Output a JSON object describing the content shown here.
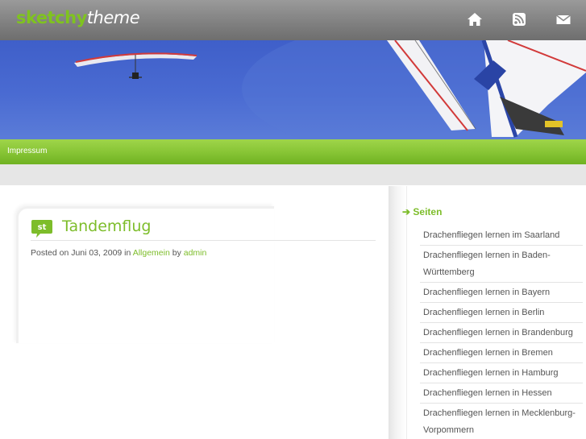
{
  "header": {
    "logo_part1": "sketchy",
    "logo_part2": "theme",
    "icons": [
      "home-icon",
      "rss-icon",
      "mail-icon"
    ]
  },
  "nav": {
    "items": [
      {
        "label": "Impressum"
      }
    ]
  },
  "post": {
    "title": "Tandemflug",
    "meta_prefix": "Posted on Juni 03, 2009 in",
    "category": "Allgemein",
    "by": "by",
    "author": "admin",
    "icon_label": "st"
  },
  "sidebar": {
    "heading": "Seiten",
    "items": [
      "Drachenfliegen lernen im Saarland",
      "Drachenfliegen lernen in Baden-Württemberg",
      "Drachenfliegen lernen in Bayern",
      "Drachenfliegen lernen in Berlin",
      "Drachenfliegen lernen in Brandenburg",
      "Drachenfliegen lernen in Bremen",
      "Drachenfliegen lernen in Hamburg",
      "Drachenfliegen lernen in Hessen",
      "Drachenfliegen lernen in Mecklenburg-Vorpommern"
    ]
  },
  "colors": {
    "accent_green": "#7dbd2a",
    "header_gray": "#8a8a8a",
    "sky_blue": "#4a6bd2"
  }
}
